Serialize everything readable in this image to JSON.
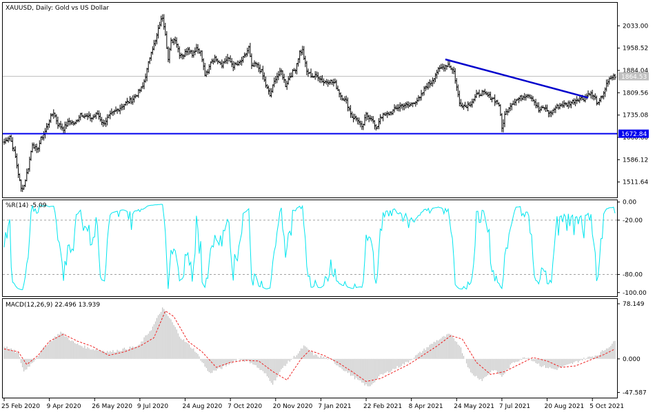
{
  "chart_data": [
    {
      "panel": "price",
      "type": "ohlc",
      "title": "XAUUSD, Daily:  Gold vs US Dollar",
      "ylim": [
        1460,
        2110
      ],
      "yticks": [
        "2033.00",
        "1958.52",
        "1884.04",
        "1809.56",
        "1735.08",
        "1660.60",
        "1586.12",
        "1511.64"
      ],
      "current_price_label": "1864.53",
      "current_price": 1864.53,
      "horizontal_line_label": "1672.84",
      "horizontal_line": 1672.84,
      "trendline": {
        "start_index": 312,
        "start": 1921,
        "end_index": 413,
        "end": 1793
      },
      "series_anchors": [
        {
          "i": 0,
          "close": 1645
        },
        {
          "i": 4,
          "close": 1665
        },
        {
          "i": 8,
          "close": 1595
        },
        {
          "i": 10,
          "close": 1540
        },
        {
          "i": 12,
          "close": 1488
        },
        {
          "i": 14,
          "close": 1500
        },
        {
          "i": 17,
          "close": 1560
        },
        {
          "i": 20,
          "close": 1640
        },
        {
          "i": 23,
          "close": 1615
        },
        {
          "i": 26,
          "close": 1655
        },
        {
          "i": 29,
          "close": 1680
        },
        {
          "i": 32,
          "close": 1720
        },
        {
          "i": 35,
          "close": 1745
        },
        {
          "i": 38,
          "close": 1705
        },
        {
          "i": 42,
          "close": 1690
        },
        {
          "i": 46,
          "close": 1715
        },
        {
          "i": 50,
          "close": 1705
        },
        {
          "i": 54,
          "close": 1740
        },
        {
          "i": 58,
          "close": 1730
        },
        {
          "i": 62,
          "close": 1725
        },
        {
          "i": 66,
          "close": 1740
        },
        {
          "i": 70,
          "close": 1705
        },
        {
          "i": 74,
          "close": 1730
        },
        {
          "i": 78,
          "close": 1745
        },
        {
          "i": 82,
          "close": 1760
        },
        {
          "i": 86,
          "close": 1775
        },
        {
          "i": 90,
          "close": 1785
        },
        {
          "i": 94,
          "close": 1805
        },
        {
          "i": 98,
          "close": 1830
        },
        {
          "i": 101,
          "close": 1885
        },
        {
          "i": 104,
          "close": 1950
        },
        {
          "i": 107,
          "close": 1980
        },
        {
          "i": 110,
          "close": 2040
        },
        {
          "i": 112,
          "close": 2063
        },
        {
          "i": 114,
          "close": 2010
        },
        {
          "i": 116,
          "close": 1920
        },
        {
          "i": 118,
          "close": 1980
        },
        {
          "i": 121,
          "close": 1990
        },
        {
          "i": 124,
          "close": 1940
        },
        {
          "i": 127,
          "close": 1935
        },
        {
          "i": 130,
          "close": 1960
        },
        {
          "i": 133,
          "close": 1940
        },
        {
          "i": 136,
          "close": 1960
        },
        {
          "i": 139,
          "close": 1945
        },
        {
          "i": 142,
          "close": 1870
        },
        {
          "i": 144,
          "close": 1875
        },
        {
          "i": 146,
          "close": 1915
        },
        {
          "i": 150,
          "close": 1925
        },
        {
          "i": 154,
          "close": 1905
        },
        {
          "i": 158,
          "close": 1925
        },
        {
          "i": 162,
          "close": 1900
        },
        {
          "i": 166,
          "close": 1905
        },
        {
          "i": 170,
          "close": 1930
        },
        {
          "i": 173,
          "close": 1960
        },
        {
          "i": 175,
          "close": 1895
        },
        {
          "i": 178,
          "close": 1905
        },
        {
          "i": 182,
          "close": 1880
        },
        {
          "i": 185,
          "close": 1835
        },
        {
          "i": 188,
          "close": 1800
        },
        {
          "i": 192,
          "close": 1860
        },
        {
          "i": 196,
          "close": 1880
        },
        {
          "i": 199,
          "close": 1835
        },
        {
          "i": 202,
          "close": 1865
        },
        {
          "i": 206,
          "close": 1890
        },
        {
          "i": 209,
          "close": 1945
        },
        {
          "i": 211,
          "close": 1950
        },
        {
          "i": 214,
          "close": 1880
        },
        {
          "i": 218,
          "close": 1865
        },
        {
          "i": 222,
          "close": 1865
        },
        {
          "i": 226,
          "close": 1845
        },
        {
          "i": 230,
          "close": 1850
        },
        {
          "i": 234,
          "close": 1840
        },
        {
          "i": 238,
          "close": 1800
        },
        {
          "i": 242,
          "close": 1780
        },
        {
          "i": 246,
          "close": 1730
        },
        {
          "i": 250,
          "close": 1720
        },
        {
          "i": 253,
          "close": 1690
        },
        {
          "i": 256,
          "close": 1735
        },
        {
          "i": 260,
          "close": 1725
        },
        {
          "i": 263,
          "close": 1685
        },
        {
          "i": 266,
          "close": 1730
        },
        {
          "i": 270,
          "close": 1735
        },
        {
          "i": 274,
          "close": 1745
        },
        {
          "i": 278,
          "close": 1760
        },
        {
          "i": 282,
          "close": 1770
        },
        {
          "i": 286,
          "close": 1765
        },
        {
          "i": 290,
          "close": 1780
        },
        {
          "i": 294,
          "close": 1790
        },
        {
          "i": 298,
          "close": 1830
        },
        {
          "i": 302,
          "close": 1845
        },
        {
          "i": 306,
          "close": 1880
        },
        {
          "i": 310,
          "close": 1895
        },
        {
          "i": 314,
          "close": 1905
        },
        {
          "i": 318,
          "close": 1880
        },
        {
          "i": 322,
          "close": 1775
        },
        {
          "i": 326,
          "close": 1765
        },
        {
          "i": 330,
          "close": 1775
        },
        {
          "i": 334,
          "close": 1800
        },
        {
          "i": 338,
          "close": 1810
        },
        {
          "i": 342,
          "close": 1800
        },
        {
          "i": 346,
          "close": 1790
        },
        {
          "i": 350,
          "close": 1770
        },
        {
          "i": 352,
          "close": 1690
        },
        {
          "i": 354,
          "close": 1735
        },
        {
          "i": 358,
          "close": 1770
        },
        {
          "i": 362,
          "close": 1785
        },
        {
          "i": 366,
          "close": 1795
        },
        {
          "i": 370,
          "close": 1805
        },
        {
          "i": 374,
          "close": 1790
        },
        {
          "i": 378,
          "close": 1750
        },
        {
          "i": 382,
          "close": 1760
        },
        {
          "i": 386,
          "close": 1740
        },
        {
          "i": 390,
          "close": 1760
        },
        {
          "i": 394,
          "close": 1770
        },
        {
          "i": 398,
          "close": 1770
        },
        {
          "i": 402,
          "close": 1780
        },
        {
          "i": 406,
          "close": 1790
        },
        {
          "i": 410,
          "close": 1790
        },
        {
          "i": 414,
          "close": 1810
        },
        {
          "i": 418,
          "close": 1790
        },
        {
          "i": 420,
          "close": 1770
        },
        {
          "i": 423,
          "close": 1800
        },
        {
          "i": 426,
          "close": 1835
        },
        {
          "i": 429,
          "close": 1860
        },
        {
          "i": 432,
          "close": 1865
        }
      ],
      "count": 433,
      "colors": {
        "bars": "#000000",
        "current_line": "#c0c0c0",
        "level_line": "#0000ee",
        "trendline": "#0000cc",
        "label_bg_current": "#c0c0c0",
        "label_bg_level": "#0000ee"
      }
    },
    {
      "panel": "williams_r",
      "type": "line",
      "title": "%R(14) -5.09",
      "ylim": [
        -104,
        2
      ],
      "yticks": [
        "0.00",
        "-20.00",
        "-80.00",
        "-100.00"
      ],
      "levels": [
        -20,
        -80
      ],
      "color": "#00e5ee"
    },
    {
      "panel": "macd",
      "type": "histogram+line",
      "title": "MACD(12,26,9) 22.496 13.939",
      "ylim": [
        -55,
        85
      ],
      "yticks": [
        "78.149",
        "0.000",
        "-47.587"
      ],
      "histogram_anchors": [
        {
          "i": 0,
          "v": 18
        },
        {
          "i": 10,
          "v": 8
        },
        {
          "i": 14,
          "v": -18
        },
        {
          "i": 20,
          "v": -5
        },
        {
          "i": 30,
          "v": 20
        },
        {
          "i": 40,
          "v": 38
        },
        {
          "i": 50,
          "v": 22
        },
        {
          "i": 60,
          "v": 15
        },
        {
          "i": 75,
          "v": 10
        },
        {
          "i": 85,
          "v": 14
        },
        {
          "i": 95,
          "v": 18
        },
        {
          "i": 105,
          "v": 45
        },
        {
          "i": 112,
          "v": 72
        },
        {
          "i": 118,
          "v": 55
        },
        {
          "i": 125,
          "v": 30
        },
        {
          "i": 135,
          "v": 12
        },
        {
          "i": 145,
          "v": -20
        },
        {
          "i": 155,
          "v": -12
        },
        {
          "i": 165,
          "v": 0
        },
        {
          "i": 175,
          "v": -5
        },
        {
          "i": 185,
          "v": -22
        },
        {
          "i": 190,
          "v": -35
        },
        {
          "i": 198,
          "v": -10
        },
        {
          "i": 208,
          "v": 8
        },
        {
          "i": 212,
          "v": 18
        },
        {
          "i": 220,
          "v": 5
        },
        {
          "i": 230,
          "v": 0
        },
        {
          "i": 240,
          "v": -15
        },
        {
          "i": 250,
          "v": -30
        },
        {
          "i": 258,
          "v": -40
        },
        {
          "i": 265,
          "v": -25
        },
        {
          "i": 275,
          "v": -15
        },
        {
          "i": 285,
          "v": -5
        },
        {
          "i": 295,
          "v": 10
        },
        {
          "i": 305,
          "v": 25
        },
        {
          "i": 315,
          "v": 35
        },
        {
          "i": 322,
          "v": 20
        },
        {
          "i": 330,
          "v": -20
        },
        {
          "i": 338,
          "v": -30
        },
        {
          "i": 346,
          "v": -15
        },
        {
          "i": 352,
          "v": -25
        },
        {
          "i": 360,
          "v": -5
        },
        {
          "i": 370,
          "v": 3
        },
        {
          "i": 380,
          "v": -10
        },
        {
          "i": 390,
          "v": -15
        },
        {
          "i": 400,
          "v": -8
        },
        {
          "i": 410,
          "v": 0
        },
        {
          "i": 420,
          "v": 6
        },
        {
          "i": 428,
          "v": 18
        },
        {
          "i": 432,
          "v": 25
        }
      ],
      "signal_anchors": [
        {
          "i": 0,
          "v": 14
        },
        {
          "i": 10,
          "v": 10
        },
        {
          "i": 16,
          "v": -8
        },
        {
          "i": 24,
          "v": 5
        },
        {
          "i": 32,
          "v": 25
        },
        {
          "i": 42,
          "v": 35
        },
        {
          "i": 52,
          "v": 25
        },
        {
          "i": 62,
          "v": 18
        },
        {
          "i": 74,
          "v": 5
        },
        {
          "i": 85,
          "v": 10
        },
        {
          "i": 96,
          "v": 18
        },
        {
          "i": 106,
          "v": 30
        },
        {
          "i": 114,
          "v": 68
        },
        {
          "i": 120,
          "v": 60
        },
        {
          "i": 130,
          "v": 25
        },
        {
          "i": 140,
          "v": 10
        },
        {
          "i": 150,
          "v": -12
        },
        {
          "i": 160,
          "v": -5
        },
        {
          "i": 170,
          "v": -2
        },
        {
          "i": 180,
          "v": -3
        },
        {
          "i": 190,
          "v": -18
        },
        {
          "i": 200,
          "v": -30
        },
        {
          "i": 210,
          "v": 0
        },
        {
          "i": 216,
          "v": 12
        },
        {
          "i": 226,
          "v": 5
        },
        {
          "i": 236,
          "v": -5
        },
        {
          "i": 246,
          "v": -18
        },
        {
          "i": 256,
          "v": -32
        },
        {
          "i": 266,
          "v": -28
        },
        {
          "i": 276,
          "v": -18
        },
        {
          "i": 286,
          "v": -8
        },
        {
          "i": 296,
          "v": 5
        },
        {
          "i": 306,
          "v": 18
        },
        {
          "i": 316,
          "v": 33
        },
        {
          "i": 324,
          "v": 28
        },
        {
          "i": 334,
          "v": -5
        },
        {
          "i": 344,
          "v": -22
        },
        {
          "i": 354,
          "v": -18
        },
        {
          "i": 364,
          "v": -8
        },
        {
          "i": 374,
          "v": 2
        },
        {
          "i": 384,
          "v": -3
        },
        {
          "i": 394,
          "v": -12
        },
        {
          "i": 404,
          "v": -10
        },
        {
          "i": 414,
          "v": -2
        },
        {
          "i": 424,
          "v": 6
        },
        {
          "i": 432,
          "v": 14
        }
      ],
      "colors": {
        "histogram": "#b4b4b4",
        "signal": "#ee2222"
      }
    }
  ],
  "x_axis": {
    "labels": [
      {
        "i": 0,
        "label": "25 Feb 2020"
      },
      {
        "i": 32,
        "label": "9 Apr 2020"
      },
      {
        "i": 64,
        "label": "26 May 2020"
      },
      {
        "i": 96,
        "label": "9 Jul 2020"
      },
      {
        "i": 128,
        "label": "24 Aug 2020"
      },
      {
        "i": 160,
        "label": "7 Oct 2020"
      },
      {
        "i": 192,
        "label": "20 Nov 2020"
      },
      {
        "i": 224,
        "label": "7 Jan 2021"
      },
      {
        "i": 256,
        "label": "22 Feb 2021"
      },
      {
        "i": 288,
        "label": "8 Apr 2021"
      },
      {
        "i": 320,
        "label": "24 May 2021"
      },
      {
        "i": 352,
        "label": "7 Jul 2021"
      },
      {
        "i": 384,
        "label": "20 Aug 2021"
      },
      {
        "i": 416,
        "label": "5 Oct 2021"
      }
    ]
  }
}
